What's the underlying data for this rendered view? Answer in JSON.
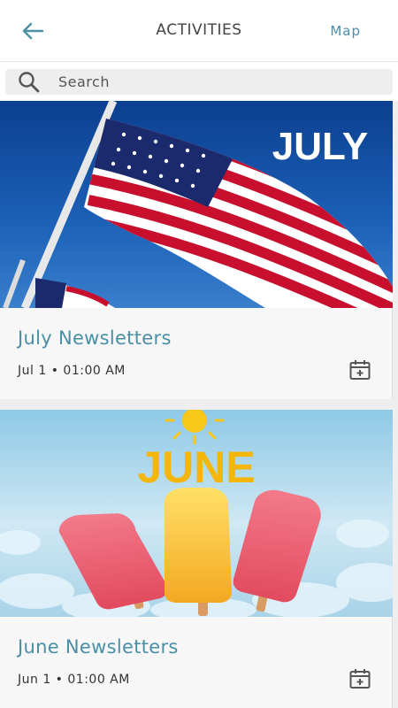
{
  "header": {
    "title": "ACTIVITIES",
    "map_label": "Map",
    "back_icon": "arrow-left-icon",
    "accent_color": "#4a8fa6"
  },
  "search": {
    "placeholder": "Search",
    "value": ""
  },
  "activities": [
    {
      "title": "July Newsletters",
      "date": "Jul 1 • 01:00 AM",
      "image_text": "JULY",
      "image_description": "american-flag-image"
    },
    {
      "title": "June Newsletters",
      "date": "Jun 1 • 01:00 AM",
      "image_text": "JUNE",
      "image_description": "popsicles-image"
    }
  ]
}
